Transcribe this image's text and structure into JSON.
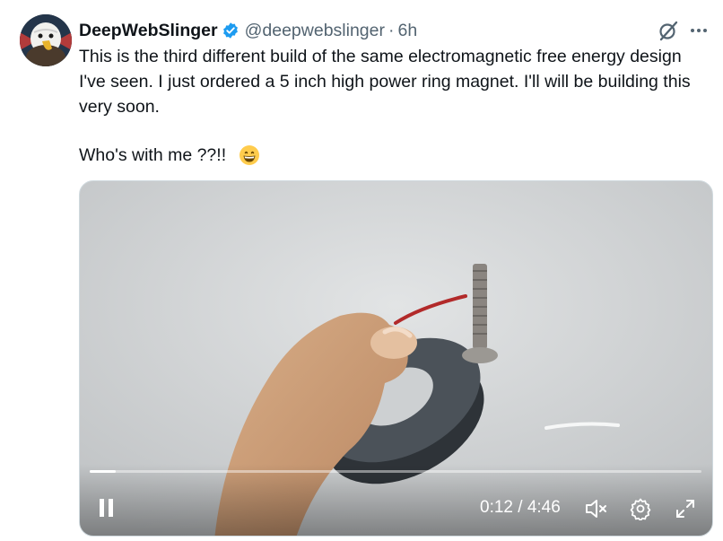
{
  "tweet": {
    "author_name": "DeepWebSlinger",
    "handle": "@deepwebslinger",
    "separator": "·",
    "time": "6h",
    "text_line1": "This is the third different build of the same electromagnetic free energy design I've seen. I just ordered a 5 inch high power ring magnet. I'll will be building this very soon.",
    "text_line2": "Who's with me ??!!",
    "emoji": "grinning-face-emoji"
  },
  "video": {
    "current_time": "0:12",
    "duration": "4:46",
    "progress": 0.042,
    "timecode": "0:12 / 4:46"
  },
  "icons": {
    "verified": "verified-badge-icon",
    "grok": "grok-icon",
    "more": "more-icon",
    "pause": "pause-icon",
    "mute": "muted-speaker-icon",
    "settings": "settings-icon",
    "fullscreen": "fullscreen-icon"
  },
  "colors": {
    "verified_blue": "#1d9bf0",
    "secondary_text": "#536471"
  }
}
